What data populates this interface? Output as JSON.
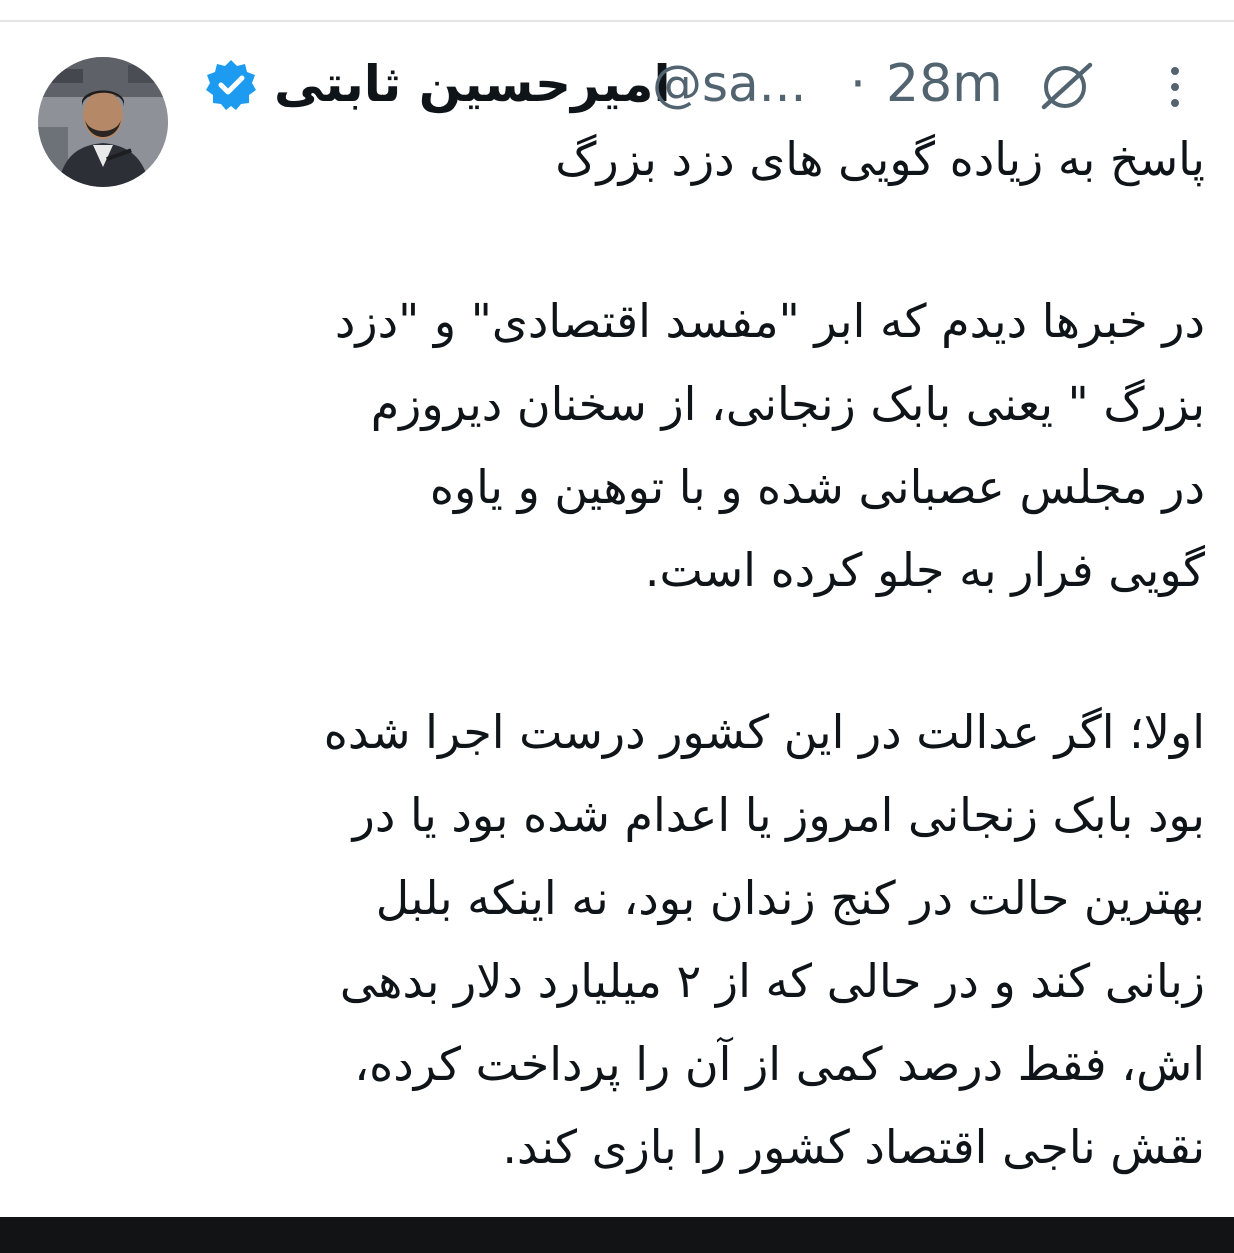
{
  "tweet": {
    "author": {
      "display_name": "امیرحسین ثابتی",
      "handle": "@sa...",
      "verified_icon": "verified-badge-icon",
      "avatar": "profile-photo"
    },
    "time_separator": "·",
    "timestamp": "28m",
    "icons": {
      "grok": "grok-icon",
      "more": "more-options-icon"
    },
    "title": "پاسخ به زیاده گویی های دزد بزرگ",
    "paragraph1": [
      "در خبرها دیدم که ابر \"مفسد اقتصادی\" و \"دزد",
      "بزرگ \" یعنی بابک زنجانی، از سخنان دیروزم",
      "در مجلس عصبانی شده و با توهین و یاوه",
      "گویی فرار به جلو کرده است."
    ],
    "paragraph2": [
      "اولا؛ اگر عدالت در این کشور درست اجرا شده",
      "بود بابک زنجانی امروز یا اعدام شده بود یا در",
      "بهترین حالت در کنج زندان بود، نه اینکه بلبل",
      "زبانی کند و در حالی که از ۲ میلیارد دلار بدهی",
      "اش، فقط درصد کمی از آن را پرداخت کرده،",
      "نقش ناجی اقتصاد کشور را بازی کند."
    ]
  },
  "colors": {
    "text": "#0f1419",
    "secondary": "#536471",
    "verified": "#1d9bf0",
    "background": "#ffffff"
  }
}
